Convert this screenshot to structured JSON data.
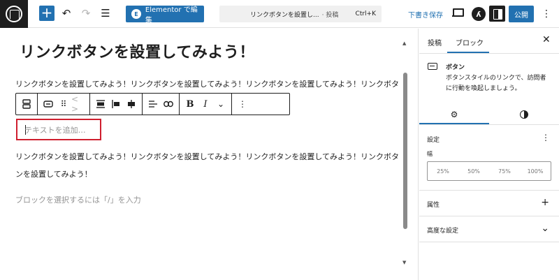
{
  "topbar": {
    "add_label": "+",
    "undo_icon": "↶",
    "redo_icon": "↷",
    "list_view_icon": "☰",
    "elementor_badge": "E",
    "elementor_label": "Elementor で編集",
    "command_title": "リンクボタンを設置し...",
    "command_type": "· 投稿",
    "command_shortcut": "Ctrl+K",
    "draft_label": "下書き保存",
    "jetpack_label": "ʎ",
    "publish_label": "公開",
    "more_label": "⋮"
  },
  "editor": {
    "post_title": "リンクボタンを設置してみよう！",
    "paragraph1": "リンクボタンを設置してみよう！リンクボタンを設置してみよう！リンクボタンを設置してみよう！リンクボタンを設置してみよう！",
    "paragraph1_peek": "を",
    "button_placeholder": "テキストを追加…",
    "paragraph2": "リンクボタンを設置してみよう！リンクボタンを設置してみよう！リンクボタンを設置してみよう！リンクボタンを設置してみよう！",
    "block_hint": "ブロックを選択するには「/」を入力"
  },
  "block_toolbar": {
    "bold_label": "B",
    "italic_label": "I",
    "more_label": "⋮",
    "chevron_label": "⌄",
    "code_label": "< >",
    "drag_label": "⠿"
  },
  "scrollbar": {
    "up": "▲",
    "down": "▼"
  },
  "sidebar": {
    "tab_post": "投稿",
    "tab_block": "ブロック",
    "close_label": "✕",
    "block_name": "ボタン",
    "block_description": "ボタンスタイルのリンクで、訪問者に行動を喚起しましょう。",
    "settings_title": "設定",
    "settings_more": "⋮",
    "width_label": "幅",
    "width_options": [
      "25%",
      "50%",
      "75%",
      "100%"
    ],
    "attributes_label": "属性",
    "attributes_icon": "+",
    "advanced_label": "高度な設定",
    "advanced_icon": "⌄"
  },
  "colors": {
    "accent": "#2271b1",
    "highlight_border": "#cf1f2f",
    "dark": "#1e1e1e"
  }
}
